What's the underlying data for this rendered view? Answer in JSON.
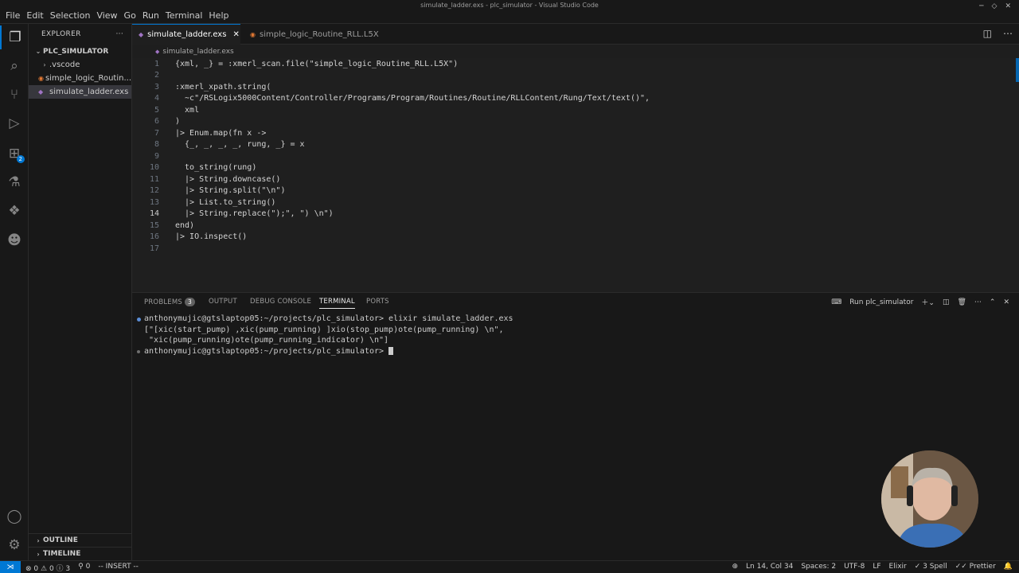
{
  "window": {
    "title": "simulate_ladder.exs - plc_simulator - Visual Studio Code",
    "menu": [
      "File",
      "Edit",
      "Selection",
      "View",
      "Go",
      "Run",
      "Terminal",
      "Help"
    ]
  },
  "activity_bar": {
    "extensions_badge": "2"
  },
  "sidebar": {
    "header": "EXPLORER",
    "more": "···",
    "folder": "PLC_SIMULATOR",
    "items": [
      {
        "label": ".vscode",
        "type": "folder"
      },
      {
        "label": "simple_logic_Routin...",
        "type": "file"
      },
      {
        "label": "simulate_ladder.exs",
        "type": "file",
        "selected": true
      }
    ],
    "outline": "OUTLINE",
    "timeline": "TIMELINE"
  },
  "tabs": [
    {
      "label": "simulate_ladder.exs",
      "active": true,
      "close": "✕"
    },
    {
      "label": "simple_logic_Routine_RLL.L5X",
      "active": false
    }
  ],
  "breadcrumb": "simulate_ladder.exs",
  "editor": {
    "current_line": 14,
    "lines": [
      {
        "n": "1",
        "text": "{xml, _} = :xmerl_scan.file(\"simple_logic_Routine_RLL.L5X\")"
      },
      {
        "n": "2",
        "text": ""
      },
      {
        "n": "3",
        "text": ":xmerl_xpath.string("
      },
      {
        "n": "4",
        "text": "  ~c\"/RSLogix5000Content/Controller/Programs/Program/Routines/Routine/RLLContent/Rung/Text/text()\","
      },
      {
        "n": "5",
        "text": "  xml"
      },
      {
        "n": "6",
        "text": ")"
      },
      {
        "n": "7",
        "text": "|> Enum.map(fn x ->"
      },
      {
        "n": "8",
        "text": "  {_, _, _, _, rung, _} = x"
      },
      {
        "n": "9",
        "text": ""
      },
      {
        "n": "10",
        "text": "  to_string(rung)"
      },
      {
        "n": "11",
        "text": "  |> String.downcase()"
      },
      {
        "n": "12",
        "text": "  |> String.split(\"\\n\")"
      },
      {
        "n": "13",
        "text": "  |> List.to_string()"
      },
      {
        "n": "14",
        "text": "  |> String.replace(\");\", \") \\n\")"
      },
      {
        "n": "15",
        "text": "end)"
      },
      {
        "n": "16",
        "text": "|> IO.inspect()"
      },
      {
        "n": "17",
        "text": ""
      }
    ]
  },
  "panel": {
    "tabs": {
      "problems": "PROBLEMS",
      "problems_count": "3",
      "output": "OUTPUT",
      "debug": "DEBUG CONSOLE",
      "terminal": "TERMINAL",
      "ports": "PORTS"
    },
    "run_label": "Run plc_simulator",
    "terminal_lines": [
      "anthonymujic@gtslaptop05:~/projects/plc_simulator> elixir simulate_ladder.exs",
      "[\"[xic(start_pump) ,xic(pump_running) ]xio(stop_pump)ote(pump_running) \\n\",",
      " \"xic(pump_running)ote(pump_running_indicator) \\n\"]",
      "anthonymujic@gtslaptop05:~/projects/plc_simulator> "
    ]
  },
  "status_bar": {
    "errors": "0",
    "warnings": "0",
    "info": "3",
    "ports": "0",
    "mode": "-- INSERT --",
    "position": "Ln 14, Col 34",
    "spaces": "Spaces: 2",
    "encoding": "UTF-8",
    "eol": "LF",
    "language": "Elixir",
    "spell": "3 Spell",
    "formatter": "Prettier"
  },
  "colors": {
    "accent": "#0078d4",
    "background": "#1f1f1f",
    "sidebar": "#181818"
  }
}
